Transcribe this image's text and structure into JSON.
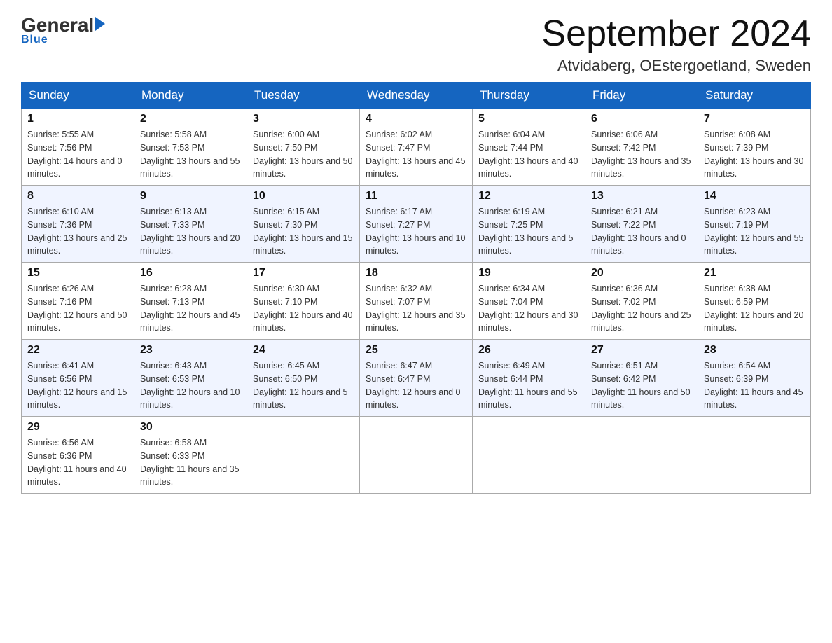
{
  "header": {
    "logo_general": "General",
    "logo_blue": "Blue",
    "month_title": "September 2024",
    "location": "Atvidaberg, OEstergoetland, Sweden"
  },
  "days_of_week": [
    "Sunday",
    "Monday",
    "Tuesday",
    "Wednesday",
    "Thursday",
    "Friday",
    "Saturday"
  ],
  "weeks": [
    [
      {
        "day": "1",
        "sunrise": "5:55 AM",
        "sunset": "7:56 PM",
        "daylight": "14 hours and 0 minutes."
      },
      {
        "day": "2",
        "sunrise": "5:58 AM",
        "sunset": "7:53 PM",
        "daylight": "13 hours and 55 minutes."
      },
      {
        "day": "3",
        "sunrise": "6:00 AM",
        "sunset": "7:50 PM",
        "daylight": "13 hours and 50 minutes."
      },
      {
        "day": "4",
        "sunrise": "6:02 AM",
        "sunset": "7:47 PM",
        "daylight": "13 hours and 45 minutes."
      },
      {
        "day": "5",
        "sunrise": "6:04 AM",
        "sunset": "7:44 PM",
        "daylight": "13 hours and 40 minutes."
      },
      {
        "day": "6",
        "sunrise": "6:06 AM",
        "sunset": "7:42 PM",
        "daylight": "13 hours and 35 minutes."
      },
      {
        "day": "7",
        "sunrise": "6:08 AM",
        "sunset": "7:39 PM",
        "daylight": "13 hours and 30 minutes."
      }
    ],
    [
      {
        "day": "8",
        "sunrise": "6:10 AM",
        "sunset": "7:36 PM",
        "daylight": "13 hours and 25 minutes."
      },
      {
        "day": "9",
        "sunrise": "6:13 AM",
        "sunset": "7:33 PM",
        "daylight": "13 hours and 20 minutes."
      },
      {
        "day": "10",
        "sunrise": "6:15 AM",
        "sunset": "7:30 PM",
        "daylight": "13 hours and 15 minutes."
      },
      {
        "day": "11",
        "sunrise": "6:17 AM",
        "sunset": "7:27 PM",
        "daylight": "13 hours and 10 minutes."
      },
      {
        "day": "12",
        "sunrise": "6:19 AM",
        "sunset": "7:25 PM",
        "daylight": "13 hours and 5 minutes."
      },
      {
        "day": "13",
        "sunrise": "6:21 AM",
        "sunset": "7:22 PM",
        "daylight": "13 hours and 0 minutes."
      },
      {
        "day": "14",
        "sunrise": "6:23 AM",
        "sunset": "7:19 PM",
        "daylight": "12 hours and 55 minutes."
      }
    ],
    [
      {
        "day": "15",
        "sunrise": "6:26 AM",
        "sunset": "7:16 PM",
        "daylight": "12 hours and 50 minutes."
      },
      {
        "day": "16",
        "sunrise": "6:28 AM",
        "sunset": "7:13 PM",
        "daylight": "12 hours and 45 minutes."
      },
      {
        "day": "17",
        "sunrise": "6:30 AM",
        "sunset": "7:10 PM",
        "daylight": "12 hours and 40 minutes."
      },
      {
        "day": "18",
        "sunrise": "6:32 AM",
        "sunset": "7:07 PM",
        "daylight": "12 hours and 35 minutes."
      },
      {
        "day": "19",
        "sunrise": "6:34 AM",
        "sunset": "7:04 PM",
        "daylight": "12 hours and 30 minutes."
      },
      {
        "day": "20",
        "sunrise": "6:36 AM",
        "sunset": "7:02 PM",
        "daylight": "12 hours and 25 minutes."
      },
      {
        "day": "21",
        "sunrise": "6:38 AM",
        "sunset": "6:59 PM",
        "daylight": "12 hours and 20 minutes."
      }
    ],
    [
      {
        "day": "22",
        "sunrise": "6:41 AM",
        "sunset": "6:56 PM",
        "daylight": "12 hours and 15 minutes."
      },
      {
        "day": "23",
        "sunrise": "6:43 AM",
        "sunset": "6:53 PM",
        "daylight": "12 hours and 10 minutes."
      },
      {
        "day": "24",
        "sunrise": "6:45 AM",
        "sunset": "6:50 PM",
        "daylight": "12 hours and 5 minutes."
      },
      {
        "day": "25",
        "sunrise": "6:47 AM",
        "sunset": "6:47 PM",
        "daylight": "12 hours and 0 minutes."
      },
      {
        "day": "26",
        "sunrise": "6:49 AM",
        "sunset": "6:44 PM",
        "daylight": "11 hours and 55 minutes."
      },
      {
        "day": "27",
        "sunrise": "6:51 AM",
        "sunset": "6:42 PM",
        "daylight": "11 hours and 50 minutes."
      },
      {
        "day": "28",
        "sunrise": "6:54 AM",
        "sunset": "6:39 PM",
        "daylight": "11 hours and 45 minutes."
      }
    ],
    [
      {
        "day": "29",
        "sunrise": "6:56 AM",
        "sunset": "6:36 PM",
        "daylight": "11 hours and 40 minutes."
      },
      {
        "day": "30",
        "sunrise": "6:58 AM",
        "sunset": "6:33 PM",
        "daylight": "11 hours and 35 minutes."
      },
      null,
      null,
      null,
      null,
      null
    ]
  ],
  "labels": {
    "sunrise_prefix": "Sunrise: ",
    "sunset_prefix": "Sunset: ",
    "daylight_prefix": "Daylight: "
  }
}
